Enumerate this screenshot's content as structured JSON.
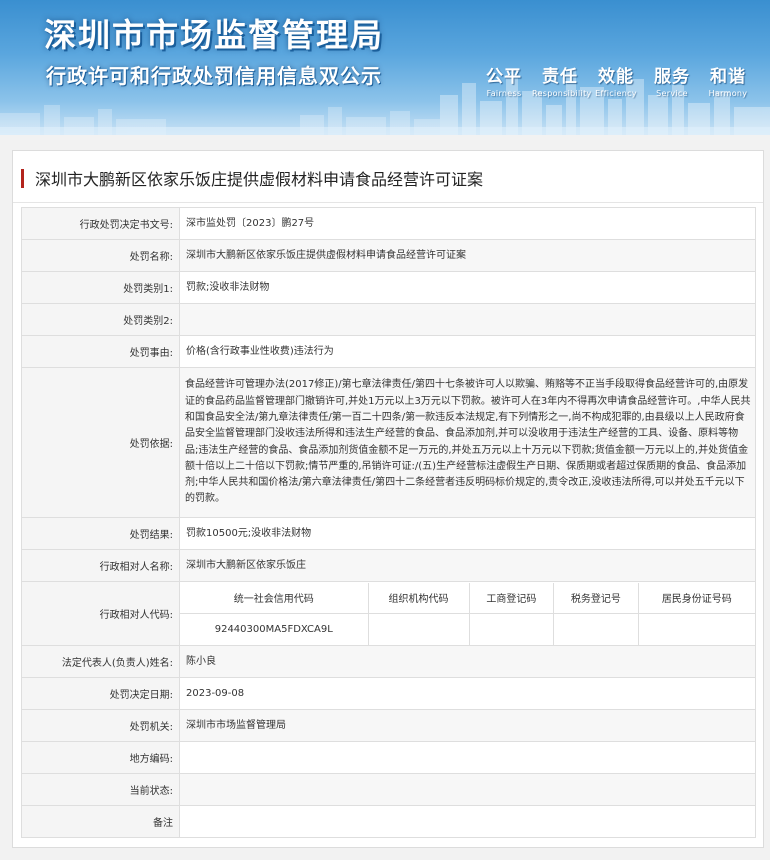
{
  "banner": {
    "title": "深圳市市场监督管理局",
    "subtitle": "行政许可和行政处罚信用信息双公示",
    "values": [
      {
        "zh": "公平",
        "en": "Fairness"
      },
      {
        "zh": "责任",
        "en": "Responsibility"
      },
      {
        "zh": "效能",
        "en": "Efficiency"
      },
      {
        "zh": "服务",
        "en": "Service"
      },
      {
        "zh": "和谐",
        "en": "Harmony"
      }
    ]
  },
  "panel": {
    "heading": "深圳市大鹏新区依家乐饭庄提供虚假材料申请食品经营许可证案"
  },
  "rows": {
    "decision_no": {
      "label": "行政处罚决定书文号:",
      "value": "深市监处罚〔2023〕鹏27号"
    },
    "case_name": {
      "label": "处罚名称:",
      "value": "深圳市大鹏新区依家乐饭庄提供虚假材料申请食品经营许可证案"
    },
    "category1": {
      "label": "处罚类别1:",
      "value": "罚款;没收非法财物"
    },
    "category2": {
      "label": "处罚类别2:",
      "value": ""
    },
    "reason": {
      "label": "处罚事由:",
      "value": "价格(含行政事业性收费)违法行为"
    },
    "basis": {
      "label": "处罚依据:",
      "value": "食品经营许可管理办法(2017修正)/第七章法律责任/第四十七条被许可人以欺骗、贿赂等不正当手段取得食品经营许可的,由原发证的食品药品监督管理部门撤销许可,并处1万元以上3万元以下罚款。被许可人在3年内不得再次申请食品经营许可。,中华人民共和国食品安全法/第九章法律责任/第一百二十四条/第一款违反本法规定,有下列情形之一,尚不构成犯罪的,由县级以上人民政府食品安全监督管理部门没收违法所得和违法生产经营的食品、食品添加剂,并可以没收用于违法生产经营的工具、设备、原料等物品;违法生产经营的食品、食品添加剂货值金额不足一万元的,并处五万元以上十万元以下罚款;货值金额一万元以上的,并处货值金额十倍以上二十倍以下罚款;情节严重的,吊销许可证:/(五)生产经营标注虚假生产日期、保质期或者超过保质期的食品、食品添加剂;中华人民共和国价格法/第六章法律责任/第四十二条经营者违反明码标价规定的,责令改正,没收违法所得,可以并处五千元以下的罚款。"
    },
    "result": {
      "label": "处罚结果:",
      "value": "罚款10500元;没收非法财物"
    },
    "party_name": {
      "label": "行政相对人名称:",
      "value": "深圳市大鹏新区依家乐饭庄"
    },
    "party_code": {
      "label": "行政相对人代码:",
      "headers": [
        "统一社会信用代码",
        "组织机构代码",
        "工商登记码",
        "税务登记号",
        "居民身份证号码"
      ],
      "values": [
        "92440300MA5FDXCA9L",
        "",
        "",
        "",
        ""
      ]
    },
    "legal_rep": {
      "label": "法定代表人(负责人)姓名:",
      "value": "陈小良"
    },
    "decision_date": {
      "label": "处罚决定日期:",
      "value": "2023-09-08"
    },
    "authority": {
      "label": "处罚机关:",
      "value": "深圳市市场监督管理局"
    },
    "area_code": {
      "label": "地方编码:",
      "value": ""
    },
    "status": {
      "label": "当前状态:",
      "value": ""
    },
    "remark": {
      "label": "备注",
      "value": ""
    }
  },
  "colors": {
    "accent_bar": "#b3241c",
    "banner_blue": "#3a8fd0"
  }
}
